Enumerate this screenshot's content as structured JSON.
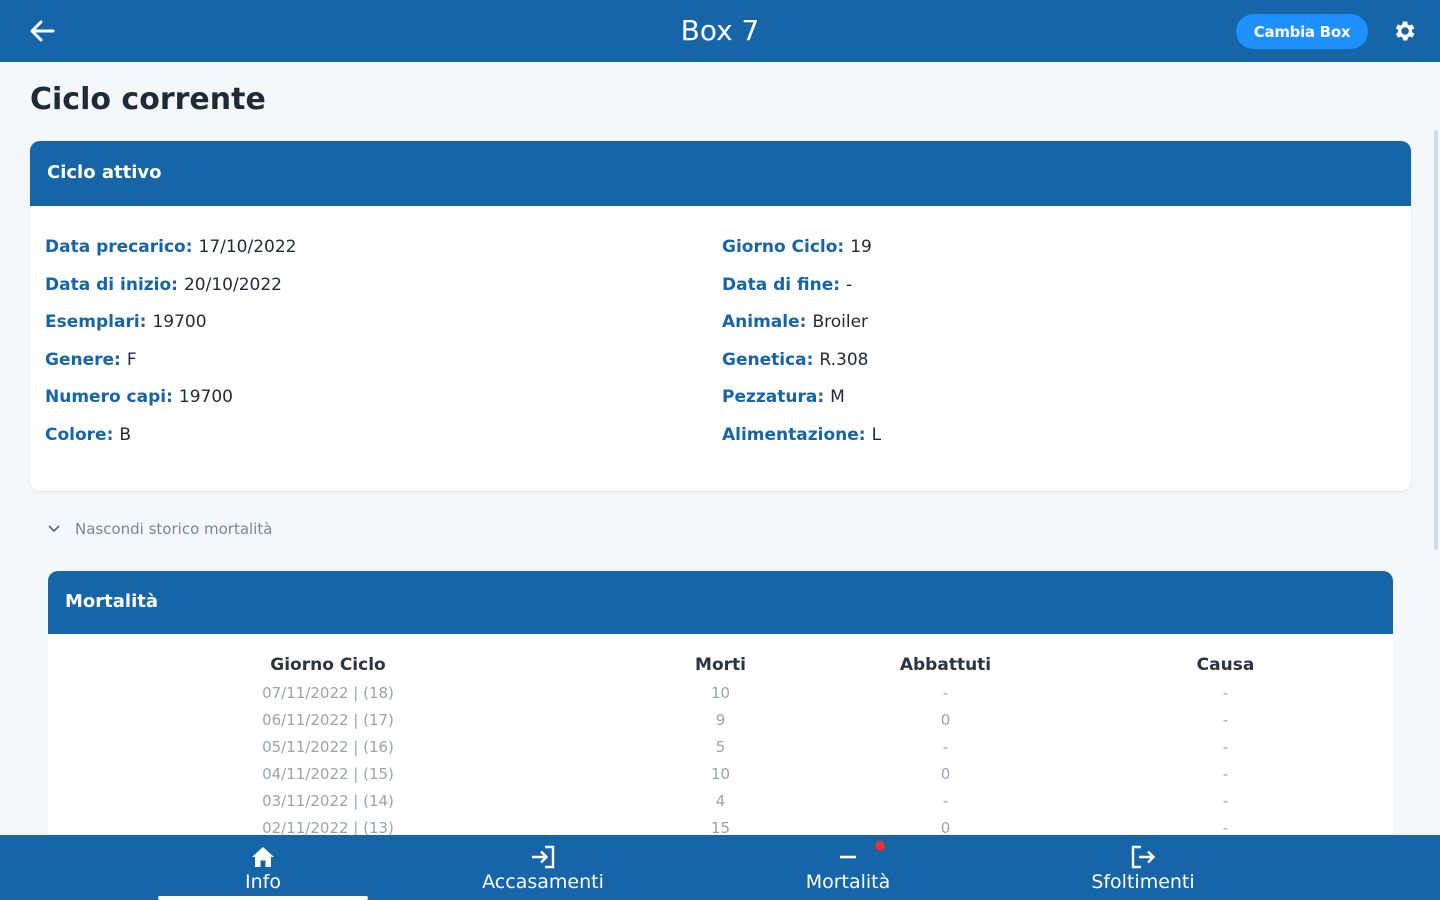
{
  "header": {
    "title": "Box 7",
    "change_box_label": "Cambia Box",
    "back_icon": "arrow-left-icon",
    "settings_icon": "gear-icon"
  },
  "page": {
    "title": "Ciclo corrente"
  },
  "cycle_card": {
    "header": "Ciclo attivo",
    "left": [
      {
        "label": "Data precarico:",
        "value": "17/10/2022"
      },
      {
        "label": "Data di inizio:",
        "value": "20/10/2022"
      },
      {
        "label": "Esemplari:",
        "value": "19700"
      },
      {
        "label": "Genere:",
        "value": "F"
      },
      {
        "label": "Numero capi:",
        "value": "19700"
      },
      {
        "label": "Colore:",
        "value": "B"
      }
    ],
    "right": [
      {
        "label": "Giorno Ciclo:",
        "value": "19"
      },
      {
        "label": "Data di fine:",
        "value": "-"
      },
      {
        "label": "Animale:",
        "value": "Broiler"
      },
      {
        "label": "Genetica:",
        "value": "R.308"
      },
      {
        "label": "Pezzatura:",
        "value": "M"
      },
      {
        "label": "Alimentazione:",
        "value": "L"
      }
    ]
  },
  "history_toggle": {
    "label": "Nascondi storico mortalità",
    "icon": "chevron-down-icon"
  },
  "mortality": {
    "header": "Mortalità",
    "columns": [
      "Giorno Ciclo",
      "Morti",
      "Abbattuti",
      "Causa"
    ],
    "rows": [
      [
        "07/11/2022 | (18)",
        "10",
        "-",
        "-"
      ],
      [
        "06/11/2022 | (17)",
        "9",
        "0",
        "-"
      ],
      [
        "05/11/2022 | (16)",
        "5",
        "-",
        "-"
      ],
      [
        "04/11/2022 | (15)",
        "10",
        "0",
        "-"
      ],
      [
        "03/11/2022 | (14)",
        "4",
        "-",
        "-"
      ],
      [
        "02/11/2022 | (13)",
        "15",
        "0",
        "-"
      ]
    ]
  },
  "bottom_nav": {
    "items": [
      {
        "label": "Info",
        "icon": "home-icon",
        "active": true
      },
      {
        "label": "Accasamenti",
        "icon": "login-icon",
        "active": false
      },
      {
        "label": "Mortalità",
        "icon": "minus-icon",
        "active": false,
        "badge": true
      },
      {
        "label": "Sfoltimenti",
        "icon": "logout-icon",
        "active": false
      }
    ]
  },
  "colors": {
    "primary": "#1565a8",
    "accent": "#1e90ff",
    "badge": "#e5342b"
  }
}
